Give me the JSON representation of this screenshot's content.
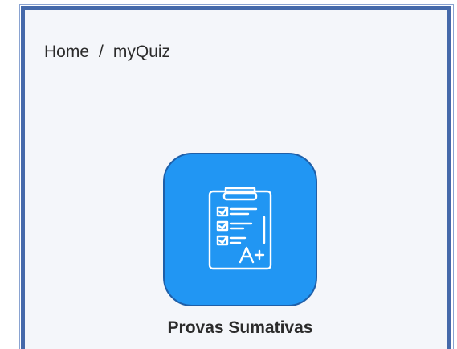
{
  "breadcrumb": {
    "items": [
      {
        "label": "Home"
      },
      {
        "label": "myQuiz"
      }
    ],
    "separator": "/"
  },
  "apps": [
    {
      "label": "Provas Sumativas",
      "icon": "quiz-checklist-icon",
      "color": "#2196f3"
    }
  ],
  "colors": {
    "frame_border": "#4569aa",
    "background": "#f4f6fa",
    "accent": "#2196f3"
  }
}
